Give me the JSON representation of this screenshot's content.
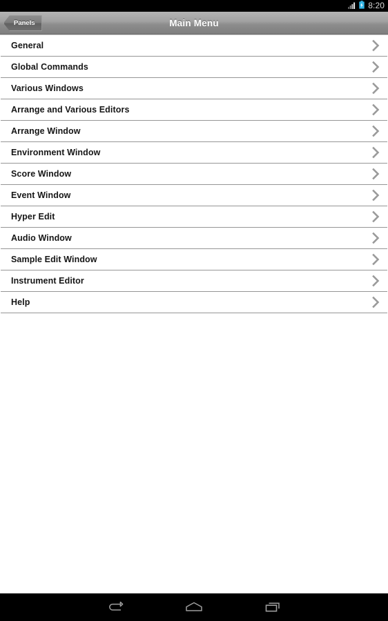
{
  "status_bar": {
    "time": "8:20",
    "icons": [
      "signal-icon",
      "battery-charging-icon"
    ],
    "background_color": "#000000",
    "time_color": "#d8d8d8",
    "battery_color": "#33b5e5"
  },
  "title_bar": {
    "title": "Main Menu",
    "back_button_label": "Panels",
    "title_color": "#ffffff"
  },
  "menu": {
    "items": [
      {
        "label": "General",
        "accessory": "chevron-right-icon"
      },
      {
        "label": "Global Commands",
        "accessory": "chevron-right-icon"
      },
      {
        "label": "Various Windows",
        "accessory": "chevron-right-icon"
      },
      {
        "label": "Arrange and Various Editors",
        "accessory": "chevron-right-icon"
      },
      {
        "label": "Arrange Window",
        "accessory": "chevron-right-icon"
      },
      {
        "label": "Environment Window",
        "accessory": "chevron-right-icon"
      },
      {
        "label": "Score Window",
        "accessory": "chevron-right-icon"
      },
      {
        "label": "Event Window",
        "accessory": "chevron-right-icon"
      },
      {
        "label": "Hyper Edit",
        "accessory": "chevron-right-icon"
      },
      {
        "label": "Audio Window",
        "accessory": "chevron-right-icon"
      },
      {
        "label": "Sample Edit Window",
        "accessory": "chevron-right-icon"
      },
      {
        "label": "Instrument Editor",
        "accessory": "chevron-right-icon"
      },
      {
        "label": "Help",
        "accessory": "chevron-right-icon"
      }
    ],
    "row_text_color": "#161616",
    "chevron_color": "#9a9a9a",
    "separator_color": "#959595",
    "background_color": "#ffffff"
  },
  "nav_bar": {
    "buttons": [
      {
        "name": "back",
        "icon": "back-arrow-icon"
      },
      {
        "name": "home",
        "icon": "home-icon"
      },
      {
        "name": "recents",
        "icon": "recent-apps-icon"
      }
    ],
    "background_color": "#000000",
    "icon_color": "#9e9e9e"
  }
}
